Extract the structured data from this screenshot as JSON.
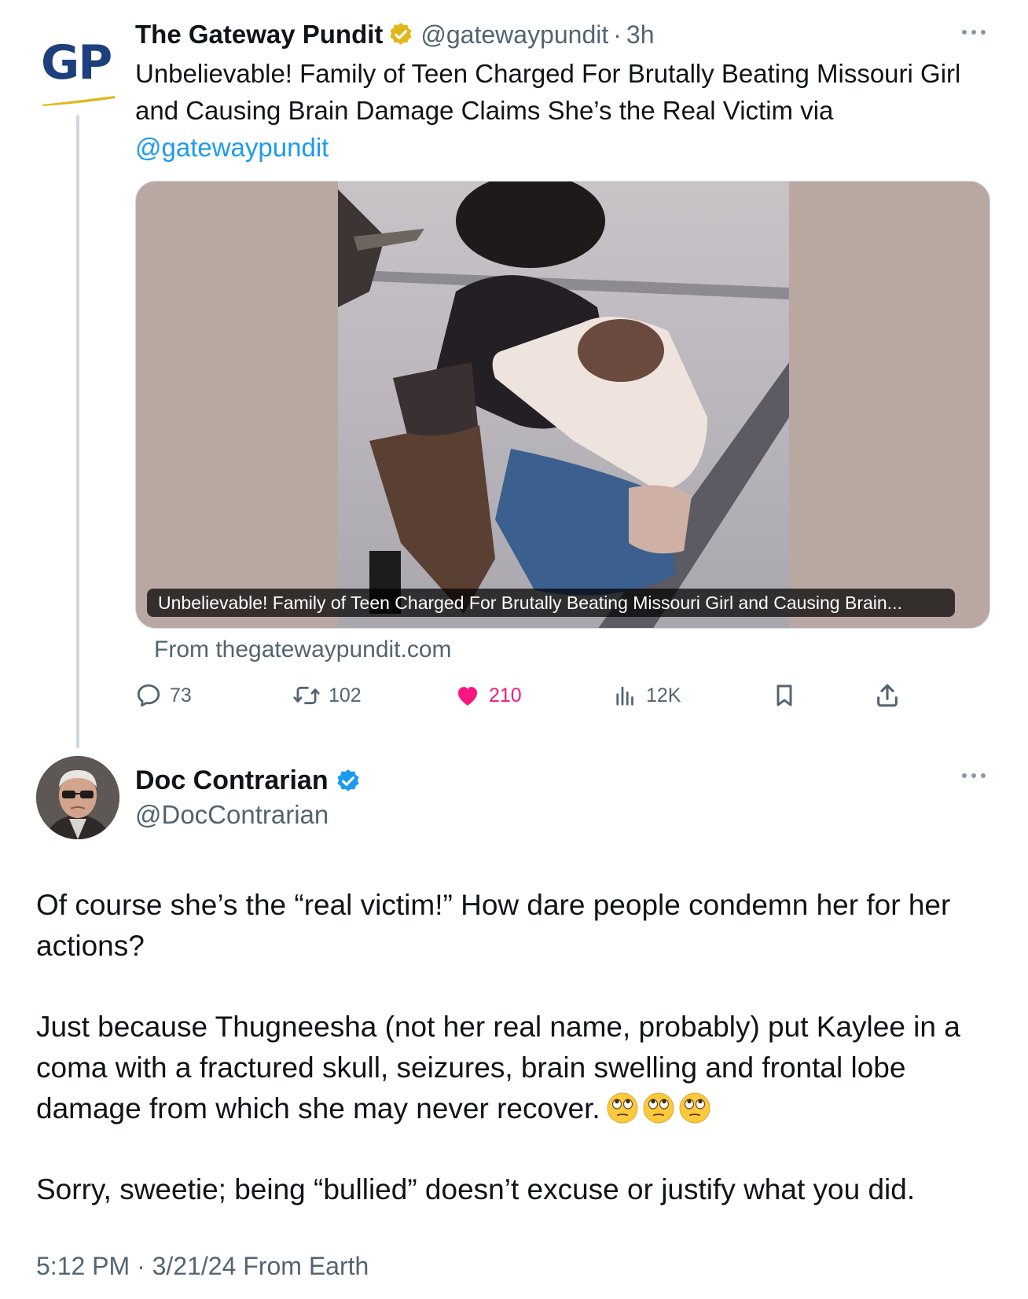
{
  "quoted_tweet": {
    "logo_text": "GP",
    "author_name": "The Gateway Pundit",
    "handle": "@gatewaypundit",
    "separator": "·",
    "time_ago": "3h",
    "text": "Unbelievable! Family of Teen Charged For Brutally Beating Missouri Girl and Causing Brain Damage Claims She’s the Real Victim via",
    "mention": "@gatewaypundit",
    "card_caption": "Unbelievable! Family of Teen Charged For Brutally Beating Missouri Girl and Causing Brain...",
    "card_source": "From thegatewaypundit.com",
    "stats": {
      "replies": "73",
      "retweets": "102",
      "likes": "210",
      "views": "12K"
    }
  },
  "main_tweet": {
    "author_name": "Doc Contrarian",
    "handle": "@DocContrarian",
    "paragraph_1": "Of course she’s the “real victim!” How dare people condemn her for her actions?",
    "paragraph_2": "Just because Thugneesha (not her real name, probably) put Kaylee in a coma with a fractured skull, seizures, brain swelling and frontal lobe damage from which she may never recover.",
    "paragraph_3": "Sorry, sweetie; being “bullied” doesn’t excuse or justify what you did.",
    "emojis": [
      "face-with-rolling-eyes",
      "face-with-rolling-eyes",
      "face-with-rolling-eyes"
    ],
    "timestamp": "5:12 PM · 3/21/24 From Earth"
  },
  "colors": {
    "text": "#0f1419",
    "secondary": "#536471",
    "link": "#1d9bf0",
    "like": "#f91880",
    "verified_gold": "#e2b719",
    "verified_blue": "#1d9bf0",
    "gp_blue": "#1e3f7e",
    "card_background": "#b9a8a2"
  }
}
